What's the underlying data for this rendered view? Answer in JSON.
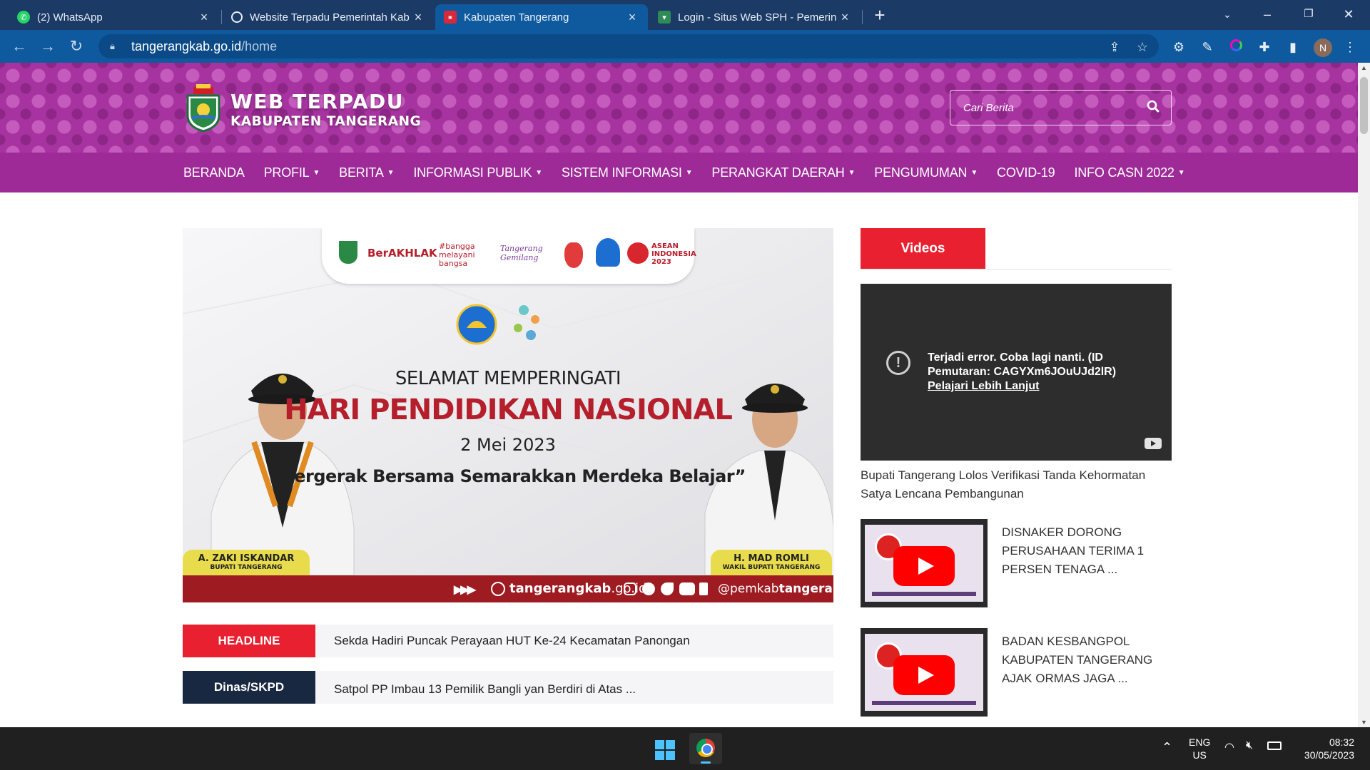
{
  "browser": {
    "tabs": [
      {
        "title": "(2) WhatsApp",
        "icon": "whatsapp-icon",
        "active": false
      },
      {
        "title": "Website Terpadu Pemerintah Kab",
        "icon": "globe-icon",
        "active": false
      },
      {
        "title": "Kabupaten Tangerang",
        "icon": "site-favicon-icon",
        "active": true
      },
      {
        "title": "Login - Situs Web SPH - Pemerin",
        "icon": "kab-emblem-icon",
        "active": false
      }
    ],
    "url_host": "tangerangkab.go.id",
    "url_path": "/home",
    "profile_initial": "N",
    "colors": {
      "tabbar": "#1b3a66",
      "toolbar": "#0f5a9e"
    }
  },
  "site": {
    "logo_title": "WEB TERPADU",
    "logo_subtitle": "KABUPATEN TANGERANG",
    "search_placeholder": "Cari Berita",
    "colors": {
      "header": "#a6339f",
      "nav": "#9e2a98",
      "accent_red": "#e8202f",
      "dark_tag": "#182840"
    },
    "nav": [
      {
        "label": "BERANDA",
        "dropdown": false
      },
      {
        "label": "PROFIL",
        "dropdown": true
      },
      {
        "label": "BERITA",
        "dropdown": true
      },
      {
        "label": "INFORMASI PUBLIK",
        "dropdown": true
      },
      {
        "label": "SISTEM INFORMASI",
        "dropdown": true
      },
      {
        "label": "PERANGKAT DAERAH",
        "dropdown": true
      },
      {
        "label": "PENGUMUMAN",
        "dropdown": true
      },
      {
        "label": "COVID-19",
        "dropdown": false
      },
      {
        "label": "INFO CASN 2022",
        "dropdown": true
      }
    ]
  },
  "banner": {
    "top_logos": [
      "BerAKHLAK",
      "#bangga melayani bangsa",
      "Tangerang Gemilang",
      "ASEAN INDONESIA 2023"
    ],
    "greeting": "SELAMAT MEMPERINGATI",
    "event": "HARI PENDIDIKAN NASIONAL",
    "date": "2 Mei 2023",
    "quote": "“Bergerak Bersama Semarakkan Merdeka Belajar”",
    "left_person": {
      "name": "A. ZAKI ISKANDAR",
      "role": "BUPATI TANGERANG"
    },
    "right_person": {
      "name": "H. MAD ROMLI",
      "role": "WAKIL BUPATI TANGERANG"
    },
    "footer_site_bold": "tangerangkab",
    "footer_site_rest": ".go.id",
    "footer_handle_prefix": "@pemkab",
    "footer_handle_bold": "tangerang"
  },
  "headlines": [
    {
      "tag": "HEADLINE",
      "text": "Sekda Hadiri Puncak Perayaan HUT Ke-24 Kecamatan Panongan",
      "tag_color": "#e8202f"
    },
    {
      "tag": "Dinas/SKPD",
      "text": "Satpol PP Imbau 13 Pemilik Bangli yan Berdiri di Atas ...",
      "tag_color": "#182840"
    }
  ],
  "sidebar": {
    "videos_tab": "Videos",
    "player_error_line1": "Terjadi error. Coba lagi nanti. (ID Pemutaran: CAGYXm6JOuUJd2lR)",
    "player_error_link": "Pelajari Lebih Lanjut",
    "main_caption": "Bupati Tangerang Lolos Verifikasi Tanda Kehormatan Satya Lencana Pembangunan",
    "videos": [
      {
        "title": "DISNAKER DORONG PERUSAHAAN TERIMA 1 PERSEN TENAGA ..."
      },
      {
        "title": "BADAN KESBANGPOL KABUPATEN TANGERANG AJAK ORMAS JAGA ..."
      }
    ]
  },
  "taskbar": {
    "lang_line1": "ENG",
    "lang_line2": "US",
    "time": "08:32",
    "date": "30/05/2023"
  }
}
